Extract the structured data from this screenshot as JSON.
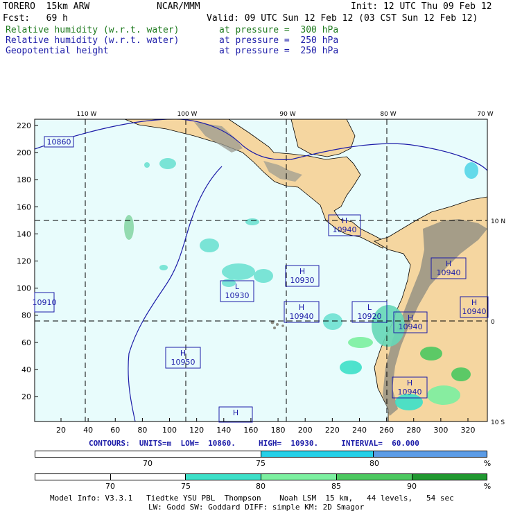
{
  "header": {
    "model": "TORERO  15km ARW",
    "center": "NCAR/MMM",
    "init": "Init: 12 UTC Thu 09 Feb 12",
    "fcst": "Fcst:   69 h",
    "valid": "Valid: 09 UTC Sun 12 Feb 12 (03 CST Sun 12 Feb 12)",
    "field1": "Relative humidity (w.r.t. water)",
    "field1_pres": "at pressure =  300 hPa",
    "field2": "Relative humidity (w.r.t. water)",
    "field2_pres": "at pressure =  250 hPa",
    "field3": "Geopotential height",
    "field3_pres": "at pressure =  250 hPa"
  },
  "map": {
    "lon_labels": [
      "110 W",
      "100 W",
      "90 W",
      "80 W",
      "70 W"
    ],
    "lat_labels": [
      "10 N",
      "0",
      "10 S"
    ],
    "y_ticks": [
      "220",
      "200",
      "180",
      "160",
      "140",
      "120",
      "100",
      "80",
      "60",
      "40",
      "20"
    ],
    "x_ticks": [
      "20",
      "40",
      "60",
      "80",
      "100",
      "120",
      "140",
      "160",
      "180",
      "200",
      "220",
      "240",
      "260",
      "280",
      "300",
      "320"
    ],
    "height_labels": [
      {
        "letter": "",
        "value": "10860"
      },
      {
        "letter": "",
        "value": "10910"
      },
      {
        "letter": "H",
        "value": "10940"
      },
      {
        "letter": "H",
        "value": "10930"
      },
      {
        "letter": "L",
        "value": "10930"
      },
      {
        "letter": "H",
        "value": "10940"
      },
      {
        "letter": "L",
        "value": "10920"
      },
      {
        "letter": "H",
        "value": "10940"
      },
      {
        "letter": "H",
        "value": "10940"
      },
      {
        "letter": "H",
        "value": "10940"
      },
      {
        "letter": "H",
        "value": "10950"
      },
      {
        "letter": "H",
        "value": "10940"
      },
      {
        "letter": "H",
        "value": ""
      }
    ],
    "colors": {
      "ocean": "#e8fcfc",
      "land": "#f5d6a0",
      "mountain": "#8a8a80",
      "contour": "#1c1ca8"
    }
  },
  "contours_text": "CONTOURS:  UNITS=m  LOW=  10860.     HIGH=  10930.     INTERVAL=  60.000",
  "colorbar1": {
    "labels": [
      "70",
      "75",
      "80",
      "%"
    ],
    "segments": [
      {
        "color": "#ffffff",
        "frac": 0.5
      },
      {
        "color": "#25d0e8",
        "frac": 0.25
      },
      {
        "color": "#5c9ce6",
        "frac": 0.25
      }
    ]
  },
  "colorbar2": {
    "labels": [
      "70",
      "75",
      "80",
      "85",
      "90",
      "%"
    ],
    "segments": [
      {
        "color": "#ffffff",
        "frac": 0.167
      },
      {
        "color": "#ffffff",
        "frac": 0.167
      },
      {
        "color": "#3de0c8",
        "frac": 0.167
      },
      {
        "color": "#7cf0a0",
        "frac": 0.167
      },
      {
        "color": "#4cc860",
        "frac": 0.167
      },
      {
        "color": "#209830",
        "frac": 0.165
      }
    ]
  },
  "footer": {
    "line1": "Model Info: V3.3.1   Tiedtke YSU PBL  Thompson    Noah LSM  15 km,   44 levels,   54 sec",
    "line2": "LW: Godd SW: Goddard DIFF: simple KM: 2D Smagor"
  }
}
